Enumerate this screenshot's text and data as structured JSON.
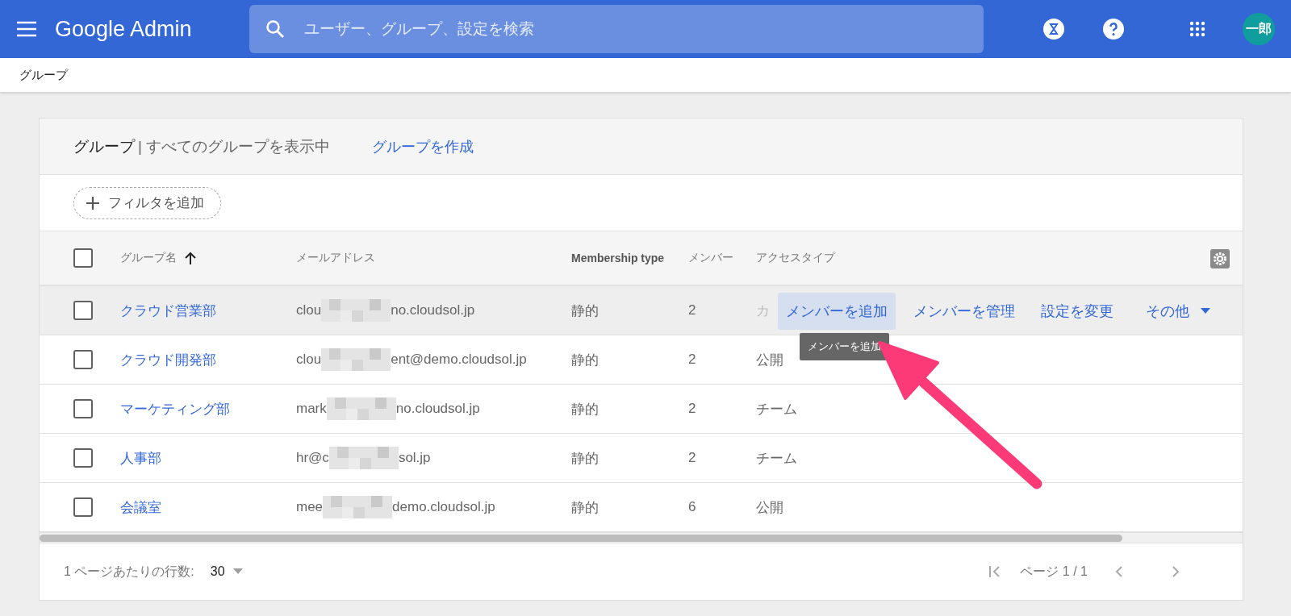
{
  "top_bar": {
    "logo": "Google Admin",
    "search": {
      "placeholder": "ユーザー、グループ、設定を検索"
    },
    "avatar": "一郎"
  },
  "breadcrumb": "グループ",
  "card": {
    "title": "グループ",
    "subtitle": "| すべてのグループを表示中",
    "create_link": "グループを作成",
    "filter_chip": "フィルタを追加"
  },
  "table": {
    "select_all_checked": false,
    "columns": [
      {
        "label": "グループ名",
        "sorted": true,
        "emphasis": false
      },
      {
        "label": "メールアドレス",
        "sorted": false,
        "emphasis": false
      },
      {
        "label": "Membership type",
        "sorted": false,
        "emphasis": true
      },
      {
        "label": "メンバー",
        "sorted": false,
        "emphasis": false
      },
      {
        "label": "アクセスタイプ",
        "sorted": false,
        "emphasis": false
      }
    ],
    "rows": [
      {
        "checked": false,
        "hovered": true,
        "name": "クラウド営業部",
        "email_start": "clou",
        "email_end": "no.cloudsol.jp",
        "type": "静的",
        "members": "2",
        "access": "カ",
        "actions": [
          {
            "label": "メンバーを追加",
            "selected": true
          },
          {
            "label": "メンバーを管理",
            "selected": false
          },
          {
            "label": "設定を変更",
            "selected": false
          },
          {
            "label": "その他",
            "selected": false
          }
        ],
        "tooltip": "メンバーを追加"
      },
      {
        "checked": false,
        "hovered": false,
        "name": "クラウド開発部",
        "email_start": "clou",
        "email_end": "ent@demo.cloudsol.jp",
        "type": "静的",
        "members": "2",
        "access": "公開"
      },
      {
        "checked": false,
        "hovered": false,
        "name": "マーケティング部",
        "email_start": "mark",
        "email_end": "no.cloudsol.jp",
        "type": "静的",
        "members": "2",
        "access": "チーム"
      },
      {
        "checked": false,
        "hovered": false,
        "name": "人事部",
        "email_start": "hr@c",
        "email_end": "sol.jp",
        "type": "静的",
        "members": "2",
        "access": "チーム"
      },
      {
        "checked": false,
        "hovered": false,
        "name": "会議室",
        "email_start": "mee",
        "email_end": "demo.cloudsol.jp",
        "type": "静的",
        "members": "6",
        "access": "公開"
      }
    ]
  },
  "footer": {
    "rows_per_page_label": "1 ページあたりの行数:",
    "rows_per_page": "30",
    "page_label": "ページ 1 / 1"
  }
}
